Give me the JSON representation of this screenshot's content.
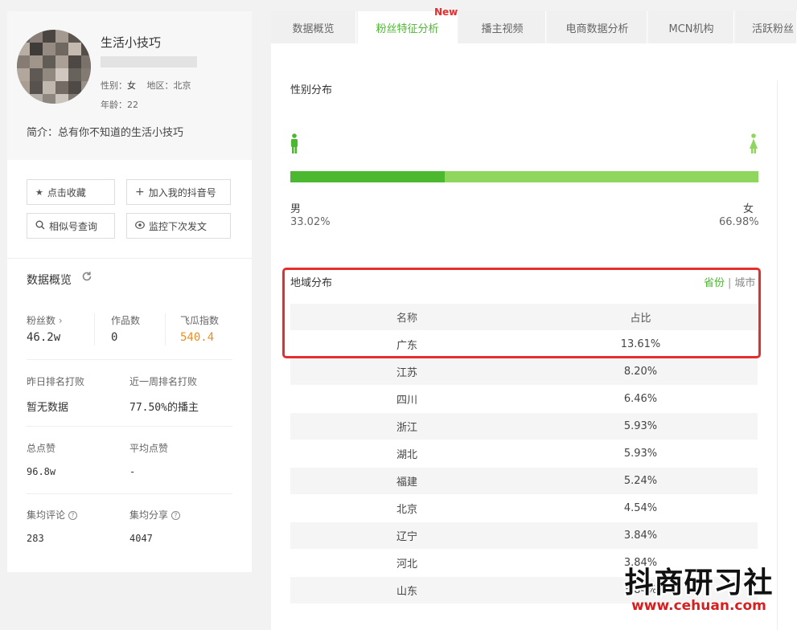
{
  "profile": {
    "name": "生活小技巧",
    "gender_label": "性别：",
    "gender_value": "女",
    "region_label": "地区：北京",
    "age_label": "年龄：",
    "age_value": "22",
    "bio": "简介：总有你不知道的生活小技巧"
  },
  "actions": {
    "favorite": "点击收藏",
    "add_account": "加入我的抖音号",
    "similar": "相似号查询",
    "monitor": "监控下次发文"
  },
  "overview": {
    "title": "数据概览",
    "fans_label": "粉丝数",
    "fans_value": "46.2w",
    "works_label": "作品数",
    "works_value": "0",
    "index_label": "飞瓜指数",
    "index_value": "540.4",
    "rank_yesterday_label": "昨日排名打败",
    "rank_yesterday_value": "暂无数据",
    "rank_week_label": "近一周排名打败",
    "rank_week_value": "77.50%的播主",
    "total_likes_label": "总点赞",
    "total_likes_value": "96.8w",
    "avg_likes_label": "平均点赞",
    "avg_likes_value": "-",
    "avg_comments_label": "集均评论",
    "avg_comments_value": "283",
    "avg_shares_label": "集均分享",
    "avg_shares_value": "4047"
  },
  "tabs": [
    {
      "label": "数据概览"
    },
    {
      "label": "粉丝特征分析"
    },
    {
      "label": "播主视频"
    },
    {
      "label": "电商数据分析"
    },
    {
      "label": "MCN机构"
    },
    {
      "label": "活跃粉丝"
    }
  ],
  "new_badge": "New",
  "gender_section": {
    "title": "性别分布",
    "male_label": "男",
    "male_pct": "33.02%",
    "male_fraction": 0.3302,
    "female_label": "女",
    "female_pct": "66.98%"
  },
  "region_section": {
    "title": "地域分布",
    "toggle_province": "省份",
    "toggle_city": "城市",
    "col_name": "名称",
    "col_ratio": "占比",
    "rows": [
      {
        "name": "广东",
        "ratio": "13.61%"
      },
      {
        "name": "江苏",
        "ratio": "8.20%"
      },
      {
        "name": "四川",
        "ratio": "6.46%"
      },
      {
        "name": "浙江",
        "ratio": "5.93%"
      },
      {
        "name": "湖北",
        "ratio": "5.93%"
      },
      {
        "name": "福建",
        "ratio": "5.24%"
      },
      {
        "name": "北京",
        "ratio": "4.54%"
      },
      {
        "name": "辽宁",
        "ratio": "3.84%"
      },
      {
        "name": "河北",
        "ratio": "3.84%"
      },
      {
        "name": "山东",
        "ratio": "3.84%"
      }
    ]
  },
  "watermark": {
    "text": "抖商研习社",
    "url": "www.cehuan.com"
  },
  "colors": {
    "accent": "#4cb82f",
    "female_bar": "#8fd65e",
    "orange": "#f08c1e",
    "highlight": "#e52e2e"
  }
}
